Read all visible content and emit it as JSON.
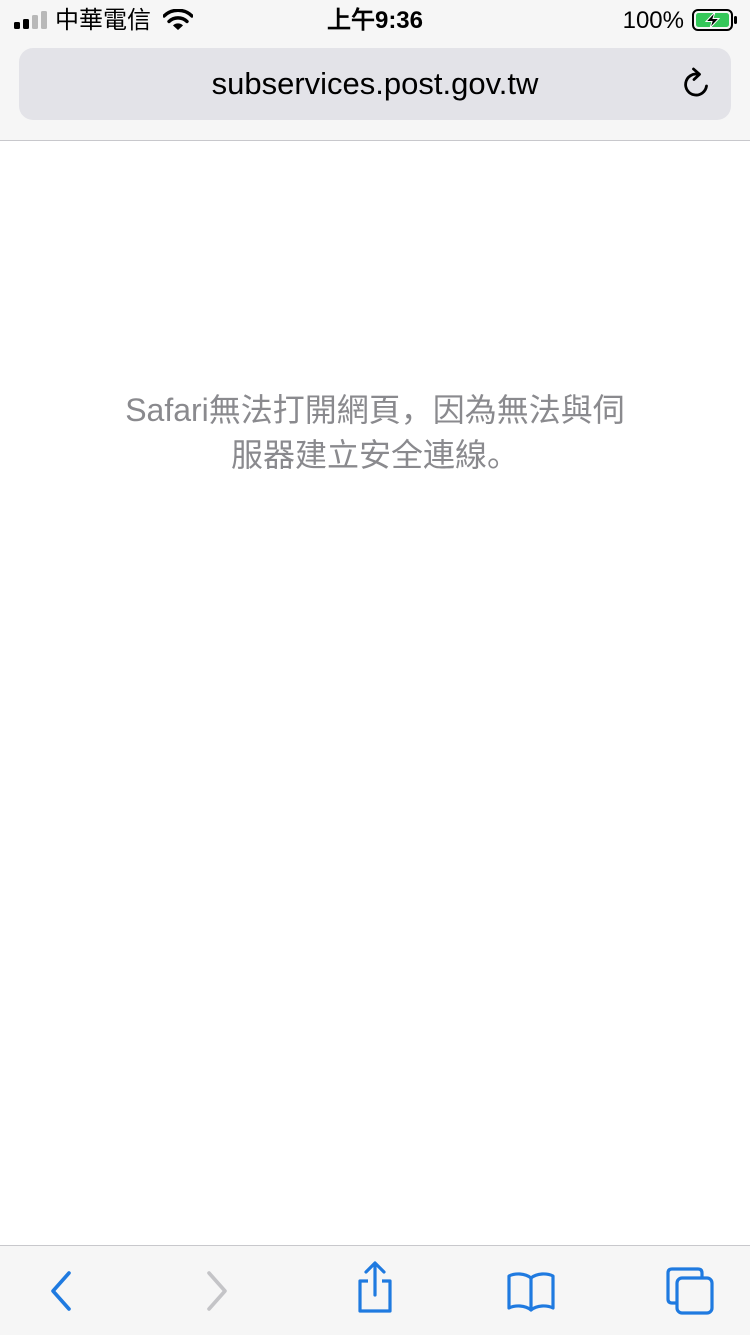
{
  "status_bar": {
    "carrier": "中華電信",
    "time": "上午9:36",
    "battery_percent": "100%",
    "signal_icon": "cellular-signal-icon",
    "wifi_icon": "wifi-icon",
    "battery_icon": "battery-charging-icon"
  },
  "address_bar": {
    "url": "subservices.post.gov.tw",
    "reload_icon": "reload-icon"
  },
  "page": {
    "error_line_1": "Safari無法打開網頁，因為無法與伺",
    "error_line_2": "服器建立安全連線。"
  },
  "toolbar": {
    "back_icon": "chevron-left-icon",
    "forward_icon": "chevron-right-icon",
    "share_icon": "share-icon",
    "bookmarks_icon": "book-icon",
    "tabs_icon": "tabs-icon"
  },
  "colors": {
    "accent": "#1f7ae0",
    "disabled": "#c4c4c7",
    "error_text": "#8a8a8e",
    "battery_green": "#34c759"
  }
}
